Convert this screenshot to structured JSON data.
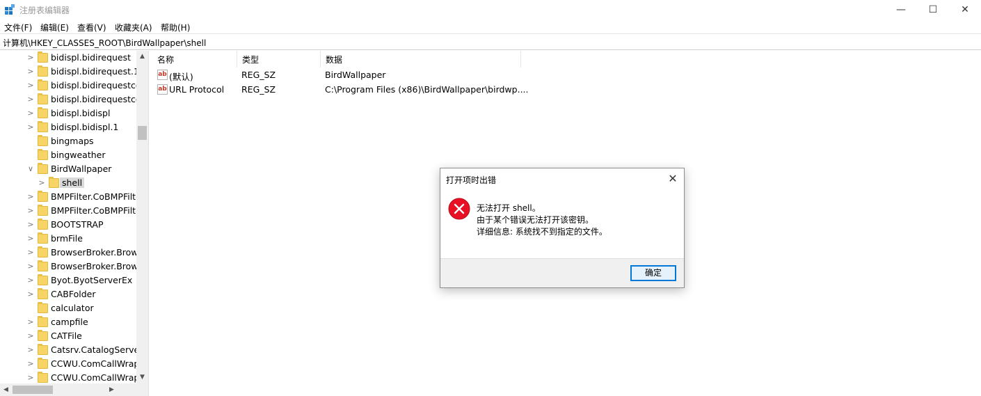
{
  "window": {
    "title": "注册表编辑器",
    "app_icon": "regedit-icon",
    "min_glyph": "—",
    "max_glyph": "☐",
    "close_glyph": "✕"
  },
  "menu": [
    "文件(F)",
    "编辑(E)",
    "查看(V)",
    "收藏夹(A)",
    "帮助(H)"
  ],
  "address": "计算机\\HKEY_CLASSES_ROOT\\BirdWallpaper\\shell",
  "tree": {
    "items": [
      {
        "label": "bidispl.bidirequest",
        "level": 1,
        "expander": ">"
      },
      {
        "label": "bidispl.bidirequest.1",
        "level": 1,
        "expander": ">"
      },
      {
        "label": "bidispl.bidirequestco",
        "level": 1,
        "expander": ">"
      },
      {
        "label": "bidispl.bidirequestco",
        "level": 1,
        "expander": ">"
      },
      {
        "label": "bidispl.bidispl",
        "level": 1,
        "expander": ">"
      },
      {
        "label": "bidispl.bidispl.1",
        "level": 1,
        "expander": ">"
      },
      {
        "label": "bingmaps",
        "level": 1,
        "expander": ""
      },
      {
        "label": "bingweather",
        "level": 1,
        "expander": ""
      },
      {
        "label": "BirdWallpaper",
        "level": 1,
        "expander": "∨"
      },
      {
        "label": "shell",
        "level": 2,
        "expander": ">",
        "selected": true
      },
      {
        "label": "BMPFilter.CoBMPFilte",
        "level": 1,
        "expander": ">"
      },
      {
        "label": "BMPFilter.CoBMPFilte",
        "level": 1,
        "expander": ">"
      },
      {
        "label": "BOOTSTRAP",
        "level": 1,
        "expander": ">"
      },
      {
        "label": "brmFile",
        "level": 1,
        "expander": ">"
      },
      {
        "label": "BrowserBroker.Brows",
        "level": 1,
        "expander": ">"
      },
      {
        "label": "BrowserBroker.Brows",
        "level": 1,
        "expander": ">"
      },
      {
        "label": "Byot.ByotServerEx",
        "level": 1,
        "expander": ">"
      },
      {
        "label": "CABFolder",
        "level": 1,
        "expander": ">"
      },
      {
        "label": "calculator",
        "level": 1,
        "expander": ""
      },
      {
        "label": "campfile",
        "level": 1,
        "expander": ">"
      },
      {
        "label": "CATFile",
        "level": 1,
        "expander": ">"
      },
      {
        "label": "Catsrv.CatalogServer",
        "level": 1,
        "expander": ">"
      },
      {
        "label": "CCWU.ComCallWrapp",
        "level": 1,
        "expander": ">"
      },
      {
        "label": "CCWU.ComCallWrapp",
        "level": 1,
        "expander": ">"
      }
    ]
  },
  "list": {
    "columns": [
      "名称",
      "类型",
      "数据"
    ],
    "rows": [
      {
        "name": "(默认)",
        "type": "REG_SZ",
        "data": "BirdWallpaper",
        "icon": "string-value-icon"
      },
      {
        "name": "URL Protocol",
        "type": "REG_SZ",
        "data": "C:\\Program Files (x86)\\BirdWallpaper\\birdwp....",
        "icon": "string-value-icon"
      }
    ]
  },
  "dialog": {
    "title": "打开项时出错",
    "close_glyph": "✕",
    "icon": "error-icon",
    "lines": [
      "无法打开 shell。",
      "由于某个错误无法打开该密钥。",
      "详细信息: 系统找不到指定的文件。"
    ],
    "ok_label": "确定"
  },
  "colors": {
    "error_red": "#e81123",
    "accent_blue": "#0078d7",
    "folder_yellow": "#f6d466"
  }
}
